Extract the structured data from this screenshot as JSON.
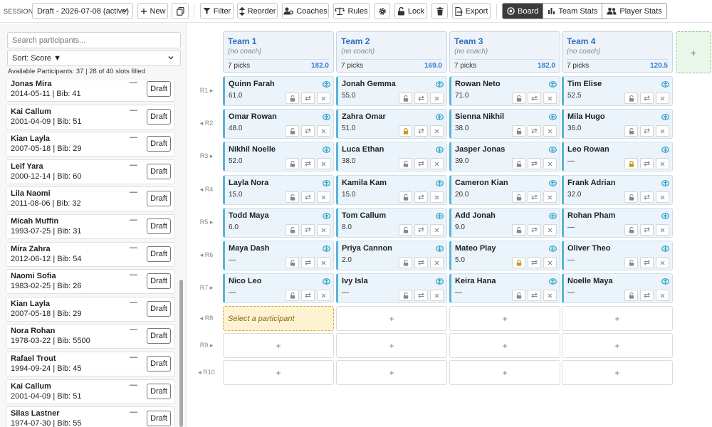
{
  "toolbar": {
    "session_label": "SESSION",
    "session_value": "Draft - 2026-07-08 (active)",
    "new_label": "New",
    "filter_label": "Filter",
    "reorder_label": "Reorder",
    "coaches_label": "Coaches",
    "rules_label": "Rules",
    "lock_label": "Lock",
    "export_label": "Export",
    "views": [
      "Board",
      "Team Stats",
      "Player Stats"
    ],
    "active_view": "Board"
  },
  "sidebar": {
    "search_placeholder": "Search participants...",
    "sort_label": "Sort: Score ▼",
    "available_text": "Available Participants: 37 | 28 of 40 slots filled",
    "draft_label": "Draft",
    "participants": [
      {
        "name": "Jonas Mira",
        "meta": "2014-05-11 | Bib: 41",
        "score": "—"
      },
      {
        "name": "Kai Callum",
        "meta": "2001-04-09 | Bib: 51",
        "score": "—"
      },
      {
        "name": "Kian Layla",
        "meta": "2007-05-18 | Bib: 29",
        "score": "—"
      },
      {
        "name": "Leif Yara",
        "meta": "2000-12-14 | Bib: 60",
        "score": "—"
      },
      {
        "name": "Lila Naomi",
        "meta": "2011-08-06 | Bib: 32",
        "score": "—"
      },
      {
        "name": "Micah Muffin",
        "meta": "1993-07-25 | Bib: 31",
        "score": "—"
      },
      {
        "name": "Mira Zahra",
        "meta": "2012-06-12 | Bib: 54",
        "score": "—"
      },
      {
        "name": "Naomi Sofia",
        "meta": "1983-02-25 | Bib: 26",
        "score": "—"
      },
      {
        "name": "Kian Layla",
        "meta": "2007-05-18 | Bib: 29",
        "score": "—"
      },
      {
        "name": "Nora Rohan",
        "meta": "1978-03-22 | Bib: 5500",
        "score": "—"
      },
      {
        "name": "Rafael Trout",
        "meta": "1994-09-24 | Bib: 45",
        "score": "—"
      },
      {
        "name": "Kai Callum",
        "meta": "2001-04-09 | Bib: 51",
        "score": "—"
      },
      {
        "name": "Silas Lastner",
        "meta": "1974-07-30 | Bib: 55",
        "score": "—"
      }
    ]
  },
  "board": {
    "rounds": [
      "R1",
      "R2",
      "R3",
      "R4",
      "R5",
      "R6",
      "R7",
      "R8",
      "R9",
      "R10"
    ],
    "add_team": "+",
    "empty_slot": "+",
    "select_prompt": "Select a participant",
    "teams": [
      {
        "name": "Team 1",
        "coach": "(no coach)",
        "picks_text": "7 picks",
        "total": "182.0",
        "picks": [
          {
            "name": "Quinn Farah",
            "score": "61.0",
            "locked": false
          },
          {
            "name": "Omar Rowan",
            "score": "48.0",
            "locked": false
          },
          {
            "name": "Nikhil Noelle",
            "score": "52.0",
            "locked": false
          },
          {
            "name": "Layla Nora",
            "score": "15.0",
            "locked": false
          },
          {
            "name": "Todd Maya",
            "score": "6.0",
            "locked": false
          },
          {
            "name": "Maya Dash",
            "score": "—",
            "locked": false
          },
          {
            "name": "Nico Leo",
            "score": "—",
            "locked": false
          }
        ]
      },
      {
        "name": "Team 2",
        "coach": "(no coach)",
        "picks_text": "7 picks",
        "total": "169.0",
        "picks": [
          {
            "name": "Jonah Gemma",
            "score": "55.0",
            "locked": false
          },
          {
            "name": "Zahra Omar",
            "score": "51.0",
            "locked": true
          },
          {
            "name": "Luca Ethan",
            "score": "38.0",
            "locked": false
          },
          {
            "name": "Kamila Kam",
            "score": "15.0",
            "locked": false
          },
          {
            "name": "Tom Callum",
            "score": "8.0",
            "locked": false
          },
          {
            "name": "Priya Cannon",
            "score": "2.0",
            "locked": false
          },
          {
            "name": "Ivy Isla",
            "score": "—",
            "locked": false
          }
        ]
      },
      {
        "name": "Team 3",
        "coach": "(no coach)",
        "picks_text": "7 picks",
        "total": "182.0",
        "picks": [
          {
            "name": "Rowan Neto",
            "score": "71.0",
            "locked": false
          },
          {
            "name": "Sienna Nikhil",
            "score": "38.0",
            "locked": false
          },
          {
            "name": "Jasper Jonas",
            "score": "39.0",
            "locked": false
          },
          {
            "name": "Cameron Kian",
            "score": "20.0",
            "locked": false
          },
          {
            "name": "Add Jonah",
            "score": "9.0",
            "locked": false
          },
          {
            "name": "Mateo Play",
            "score": "5.0",
            "locked": true
          },
          {
            "name": "Keira Hana",
            "score": "—",
            "locked": false
          }
        ]
      },
      {
        "name": "Team 4",
        "coach": "(no coach)",
        "picks_text": "7 picks",
        "total": "120.5",
        "picks": [
          {
            "name": "Tim Elise",
            "score": "52.5",
            "locked": false
          },
          {
            "name": "Mila Hugo",
            "score": "36.0",
            "locked": false
          },
          {
            "name": "Leo Rowan",
            "score": "—",
            "locked": true
          },
          {
            "name": "Frank Adrian",
            "score": "32.0",
            "locked": false
          },
          {
            "name": "Rohan Pham",
            "score": "—",
            "locked": false
          },
          {
            "name": "Oliver Theo",
            "score": "—",
            "locked": false
          },
          {
            "name": "Noelle Maya",
            "score": "—",
            "locked": false
          }
        ]
      }
    ]
  }
}
